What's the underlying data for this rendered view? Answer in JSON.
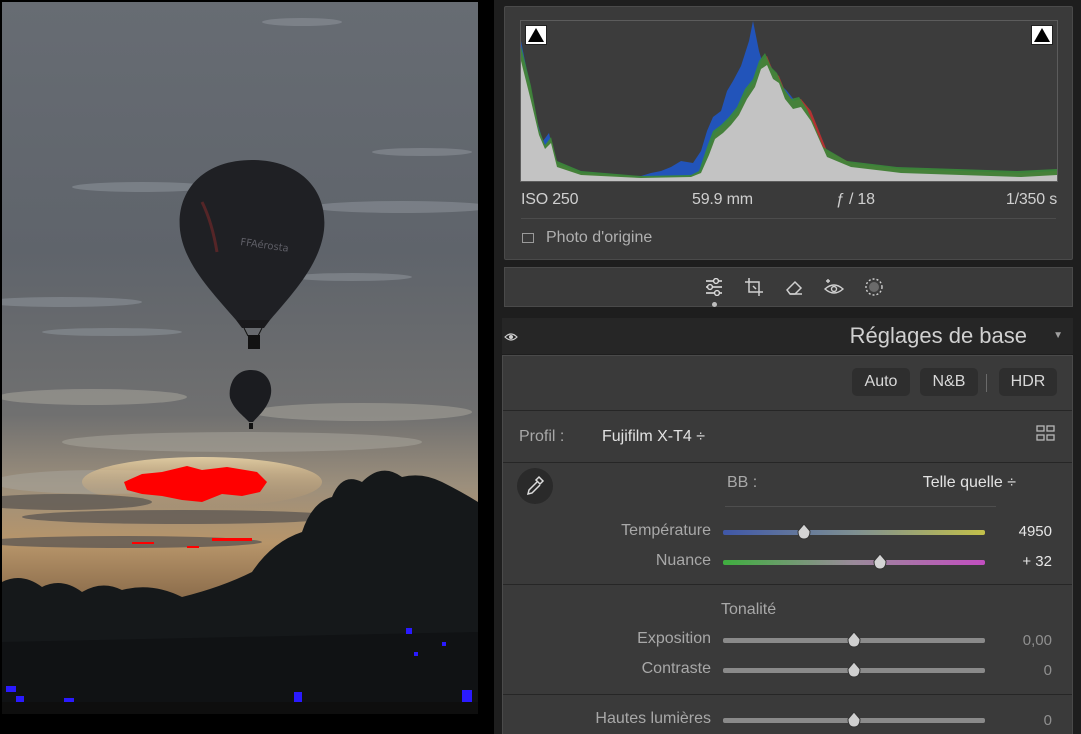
{
  "histogram": {
    "iso": "ISO 250",
    "focal": "59.9 mm",
    "aperture": "ƒ / 18",
    "shutter": "1/350 s",
    "original_photo_label": "Photo d'origine"
  },
  "tools": [
    "sliders-icon",
    "crop-icon",
    "eraser-icon",
    "redeye-icon",
    "mask-icon"
  ],
  "section": {
    "title": "Réglages de base"
  },
  "treatment": {
    "auto": "Auto",
    "bw": "N&B",
    "hdr": "HDR"
  },
  "profile": {
    "label": "Profil :",
    "value": "Fujifilm X-T4 ÷"
  },
  "white_balance": {
    "label": "BB :",
    "value": "Telle quelle ÷",
    "temperature": {
      "label": "Température",
      "value": "4950",
      "position": 0.31
    },
    "tint": {
      "label": "Nuance",
      "value": "+ 32",
      "position": 0.6
    }
  },
  "tone": {
    "heading": "Tonalité",
    "exposure": {
      "label": "Exposition",
      "value": "0,00",
      "position": 0.5
    },
    "contrast": {
      "label": "Contraste",
      "value": "0",
      "position": 0.5
    },
    "highlights": {
      "label": "Hautes lumières",
      "value": "0",
      "position": 0.5
    }
  },
  "colors": {
    "panel_bg": "#3a3a3a",
    "clip_highlight": "#ff0000",
    "clip_shadow": "#2222ff"
  }
}
